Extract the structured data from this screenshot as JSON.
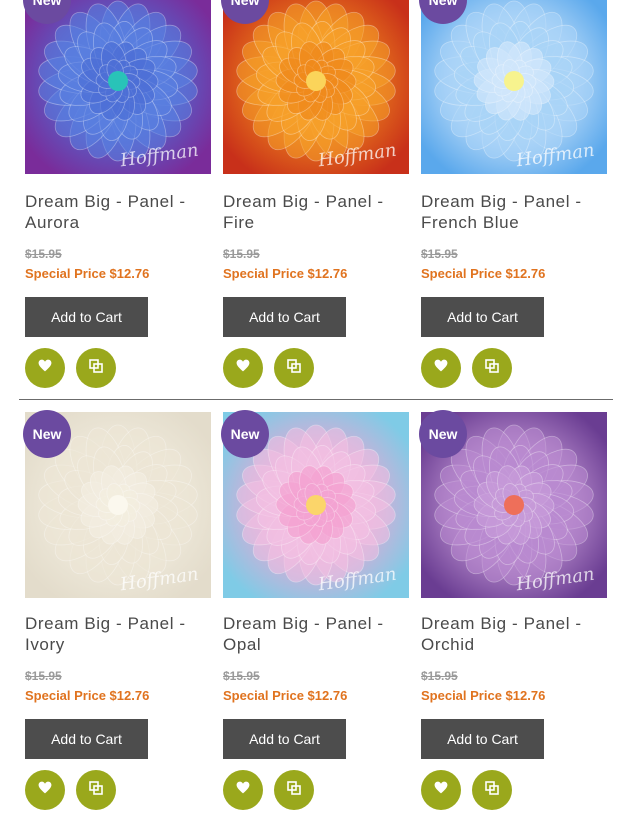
{
  "products": [
    {
      "badge": "New",
      "name": "Dream Big - Panel - Aurora",
      "old_price": "$15.95",
      "special_price": "Special Price $12.76",
      "add_to_cart": "Add to Cart",
      "watermark": "Hoffman",
      "colors": {
        "bg": "#7a2c9a",
        "mid": "#4d6fd6",
        "center": "#29c3b8",
        "petal": "#5a7fe0"
      }
    },
    {
      "badge": "New",
      "name": "Dream Big - Panel - Fire",
      "old_price": "$15.95",
      "special_price": "Special Price $12.76",
      "add_to_cart": "Add to Cart",
      "watermark": "Hoffman",
      "colors": {
        "bg": "#c8301a",
        "mid": "#f08a1c",
        "center": "#fbd45a",
        "petal": "#f6a02a"
      }
    },
    {
      "badge": "New",
      "name": "Dream Big - Panel - French Blue",
      "old_price": "$15.95",
      "special_price": "Special Price $12.76",
      "add_to_cart": "Add to Cart",
      "watermark": "Hoffman",
      "colors": {
        "bg": "#5aa8ec",
        "mid": "#cfe6fb",
        "center": "#f7f38e",
        "petal": "#a9d3f7"
      }
    },
    {
      "badge": "New",
      "name": "Dream Big - Panel - Ivory",
      "old_price": "$15.95",
      "special_price": "Special Price $12.76",
      "add_to_cart": "Add to Cart",
      "watermark": "Hoffman",
      "colors": {
        "bg": "#e3dccb",
        "mid": "#f2eddf",
        "center": "#fbf8ee",
        "petal": "#ece6d6"
      }
    },
    {
      "badge": "New",
      "name": "Dream Big - Panel - Opal",
      "old_price": "$15.95",
      "special_price": "Special Price $12.76",
      "add_to_cart": "Add to Cart",
      "watermark": "Hoffman",
      "colors": {
        "bg": "#7fcbe6",
        "mid": "#f3a3d2",
        "center": "#fbd56a",
        "petal": "#f2c0e2"
      }
    },
    {
      "badge": "New",
      "name": "Dream Big - Panel - Orchid",
      "old_price": "$15.95",
      "special_price": "Special Price $12.76",
      "add_to_cart": "Add to Cart",
      "watermark": "Hoffman",
      "colors": {
        "bg": "#6a3d92",
        "mid": "#c69ad8",
        "center": "#ee6f5a",
        "petal": "#b98ad0"
      }
    }
  ],
  "icons": {
    "wishlist": "heart-icon",
    "compare": "compare-icon"
  },
  "theme": {
    "badge": "#6b4aa0",
    "action": "#9aa81c",
    "special": "#e0731f",
    "button": "#4d4d4d"
  }
}
